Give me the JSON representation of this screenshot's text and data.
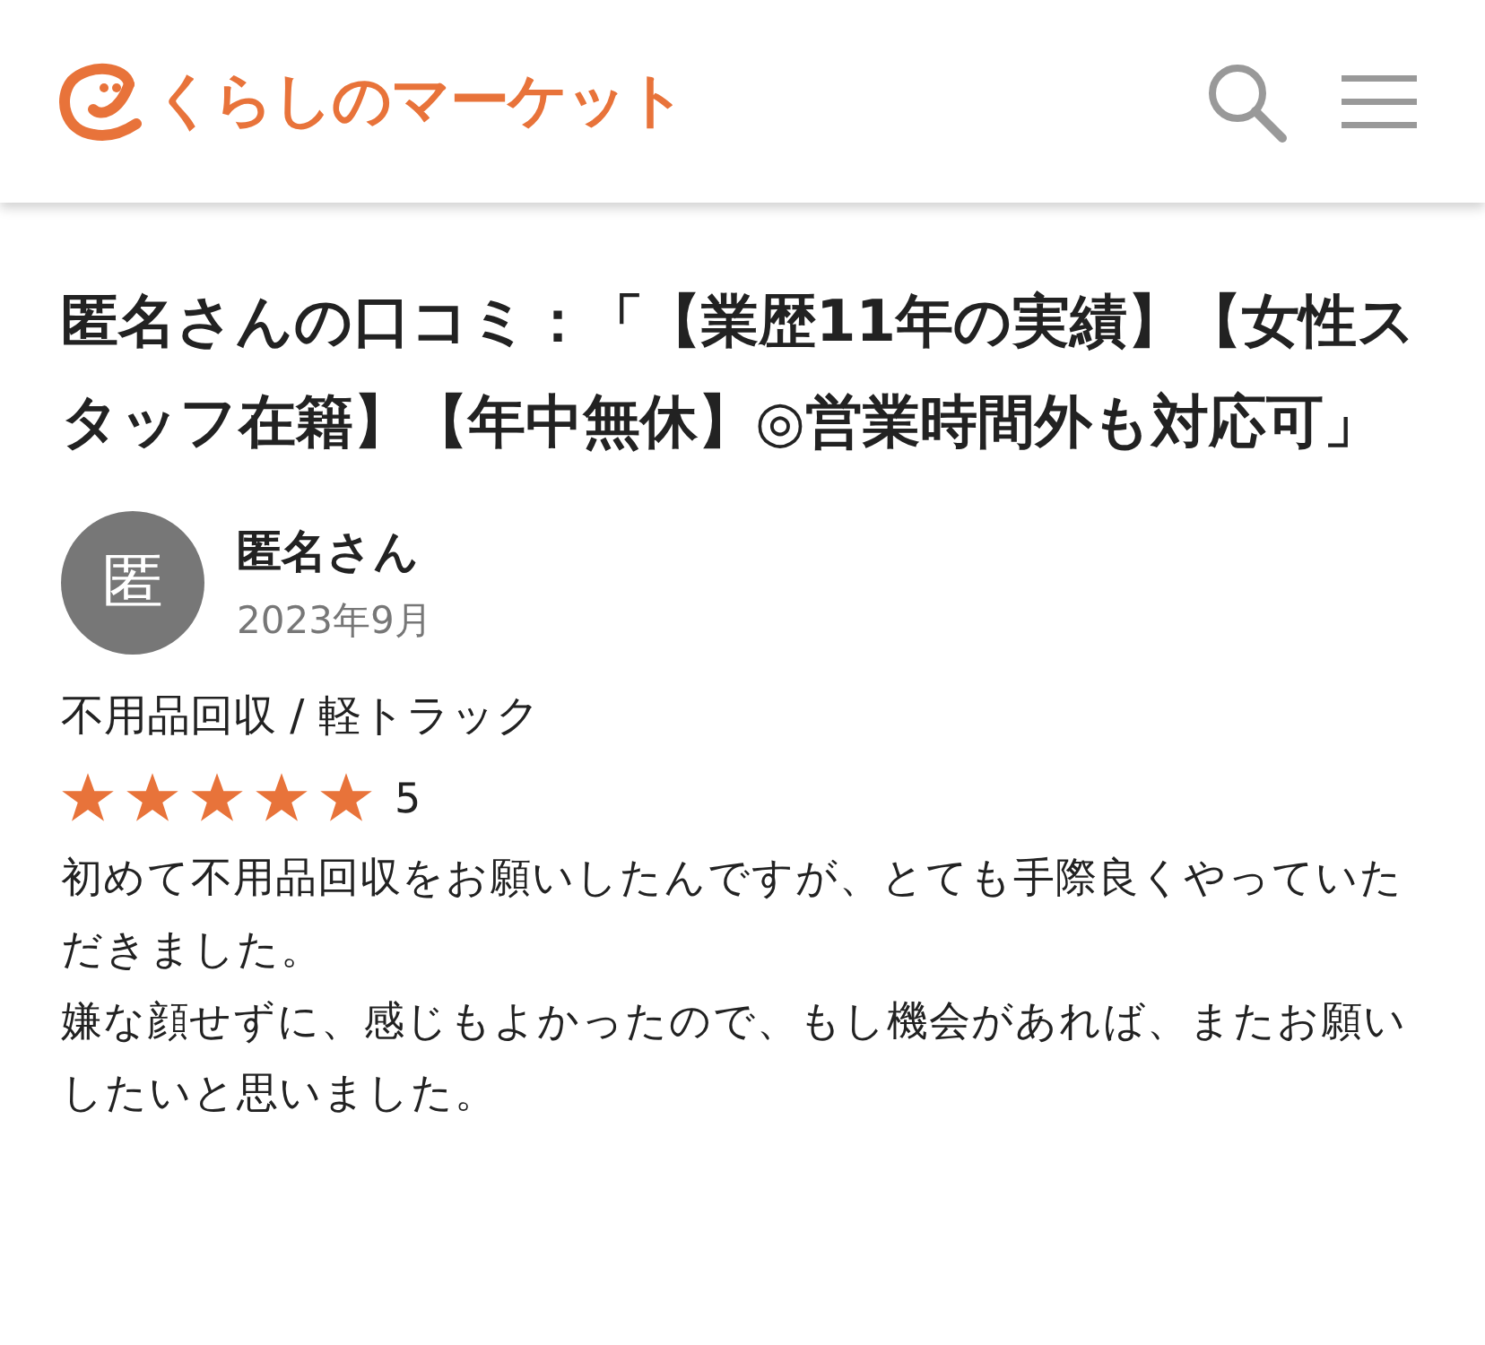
{
  "header": {
    "logo_text": "くらしのマーケット"
  },
  "title": "匿名さんの口コミ：「【業歴11年の実績】【女性スタッフ在籍】【年中無休】◎営業時間外も対応可」",
  "review": {
    "avatar_text": "匿",
    "author": "匿名さん",
    "date": "2023年9月",
    "category": "不用品回収 / 軽トラック",
    "stars": 5,
    "rating": "5",
    "paragraphs": [
      "初めて不用品回収をお願いしたんですが、とても手際良くやっていただきました。",
      "嫌な顔せずに、感じもよかったので、もし機会があれば、またお願いしたいと思いました。"
    ]
  }
}
